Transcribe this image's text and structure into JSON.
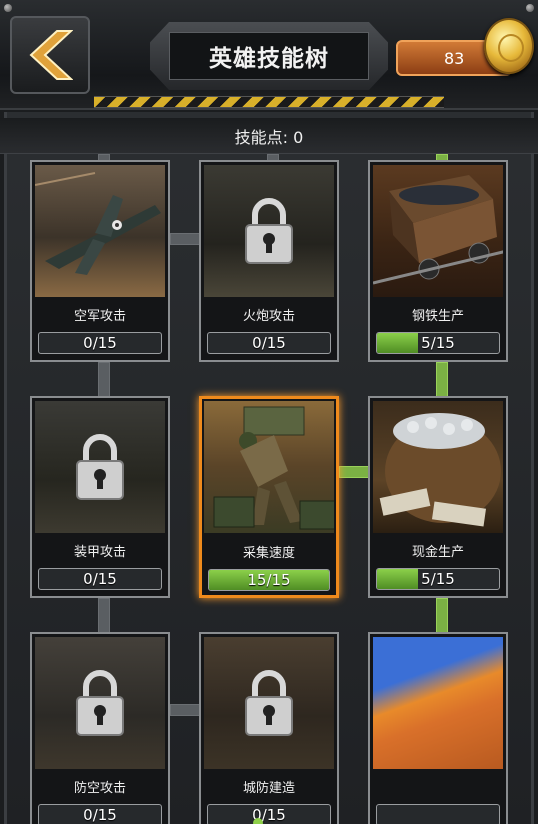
{
  "header": {
    "title": "英雄技能树",
    "coins": "83",
    "back_icon": "chevron-left-icon"
  },
  "skill_points_label": "技能点: 0",
  "colors": {
    "accent_orange": "#ef8a1c",
    "progress_green": "#6fb033",
    "coin_gold": "#e7b93a"
  },
  "skills": [
    {
      "name": "空军攻击",
      "progress_text": "0/15",
      "current": 0,
      "max": 15,
      "locked": false,
      "selected": false
    },
    {
      "name": "火炮攻击",
      "progress_text": "0/15",
      "current": 0,
      "max": 15,
      "locked": true,
      "selected": false
    },
    {
      "name": "钢铁生产",
      "progress_text": "5/15",
      "current": 5,
      "max": 15,
      "locked": false,
      "selected": false
    },
    {
      "name": "装甲攻击",
      "progress_text": "0/15",
      "current": 0,
      "max": 15,
      "locked": true,
      "selected": false
    },
    {
      "name": "采集速度",
      "progress_text": "15/15",
      "current": 15,
      "max": 15,
      "locked": false,
      "selected": true
    },
    {
      "name": "现金生产",
      "progress_text": "5/15",
      "current": 5,
      "max": 15,
      "locked": false,
      "selected": false
    },
    {
      "name": "防空攻击",
      "progress_text": "0/15",
      "current": 0,
      "max": 15,
      "locked": true,
      "selected": false
    },
    {
      "name": "城防建造",
      "progress_text": "0/15",
      "current": 0,
      "max": 15,
      "locked": true,
      "selected": false
    },
    {
      "name": "",
      "progress_text": "",
      "current": null,
      "max": null,
      "locked": false,
      "selected": false
    }
  ]
}
